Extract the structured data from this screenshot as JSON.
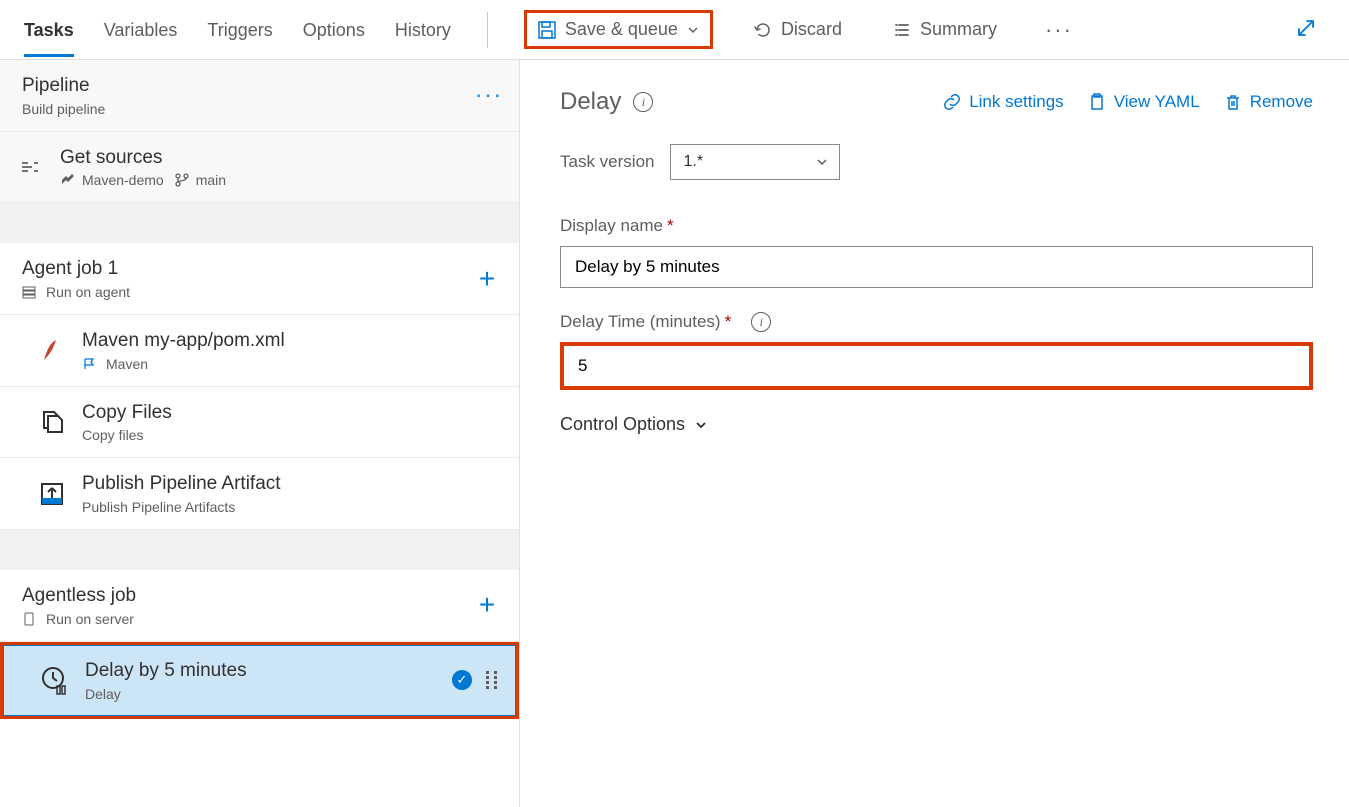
{
  "tabs": [
    "Tasks",
    "Variables",
    "Triggers",
    "Options",
    "History"
  ],
  "activeTab": 0,
  "toolbar": {
    "saveQueue": "Save & queue",
    "discard": "Discard",
    "summary": "Summary"
  },
  "sidebar": {
    "pipeline": {
      "title": "Pipeline",
      "sub": "Build pipeline"
    },
    "getSources": {
      "title": "Get sources",
      "repo": "Maven-demo",
      "branch": "main"
    },
    "agentJob": {
      "title": "Agent job 1",
      "sub": "Run on agent"
    },
    "tasks": [
      {
        "title": "Maven my-app/pom.xml",
        "sub": "Maven"
      },
      {
        "title": "Copy Files",
        "sub": "Copy files"
      },
      {
        "title": "Publish Pipeline Artifact",
        "sub": "Publish Pipeline Artifacts"
      }
    ],
    "agentlessJob": {
      "title": "Agentless job",
      "sub": "Run on server"
    },
    "selectedTask": {
      "title": "Delay by 5 minutes",
      "sub": "Delay"
    }
  },
  "panel": {
    "title": "Delay",
    "links": {
      "linkSettings": "Link settings",
      "viewYaml": "View YAML",
      "remove": "Remove"
    },
    "taskVersionLabel": "Task version",
    "taskVersionValue": "1.*",
    "displayNameLabel": "Display name",
    "displayNameValue": "Delay by 5 minutes",
    "delayTimeLabel": "Delay Time (minutes)",
    "delayTimeValue": "5",
    "controlOptions": "Control Options"
  }
}
